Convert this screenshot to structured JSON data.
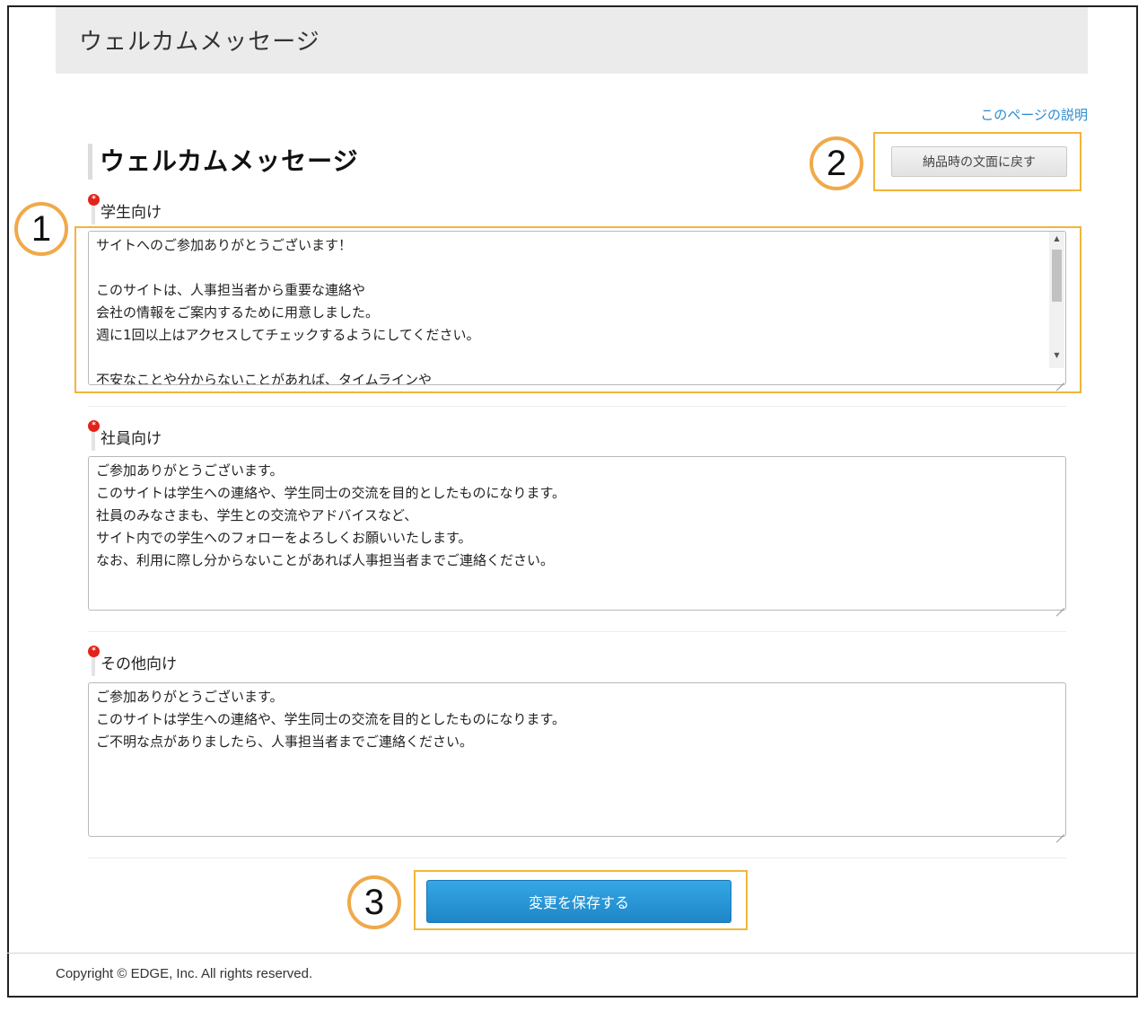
{
  "header": {
    "title": "ウェルカムメッセージ"
  },
  "help_link": "このページの説明",
  "page_heading": "ウェルカムメッセージ",
  "reset_button": "納品時の文面に戻す",
  "callouts": [
    "1",
    "2",
    "3"
  ],
  "fields": [
    {
      "label": "学生向け",
      "required": true,
      "value": "サイトへのご参加ありがとうございます！\n\nこのサイトは、人事担当者から重要な連絡や\n会社の情報をご案内するために用意しました。\n週に1回以上はアクセスしてチェックするようにしてください。\n\n不安なことや分からないことがあれば、タイムラインや"
    },
    {
      "label": "社員向け",
      "required": true,
      "value": "ご参加ありがとうございます。\nこのサイトは学生への連絡や、学生同士の交流を目的としたものになります。\n社員のみなさまも、学生との交流やアドバイスなど、\nサイト内での学生へのフォローをよろしくお願いいたします。\nなお、利用に際し分からないことがあれば人事担当者までご連絡ください。"
    },
    {
      "label": "その他向け",
      "required": true,
      "value": "ご参加ありがとうございます。\nこのサイトは学生への連絡や、学生同士の交流を目的としたものになります。\nご不明な点がありましたら、人事担当者までご連絡ください。"
    }
  ],
  "save_button": "変更を保存する",
  "footer": "Copyright © EDGE, Inc. All rights reserved.",
  "colors": {
    "highlight": "#f2b53a",
    "callout_ring": "#f0a94a",
    "primary": "#1e86c8",
    "link": "#2a8bd0",
    "required": "#e2231a"
  }
}
